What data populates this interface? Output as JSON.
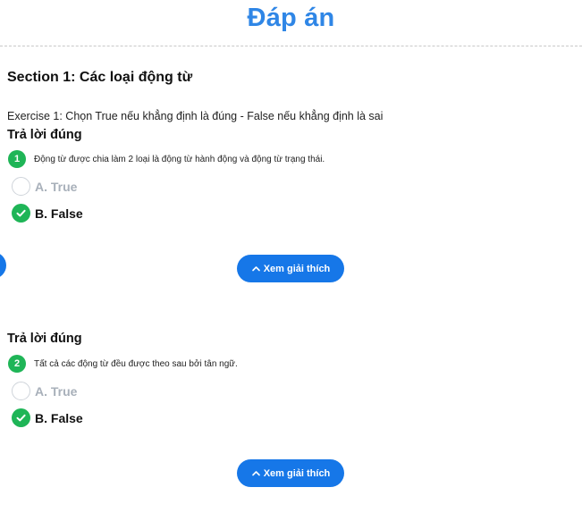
{
  "page": {
    "title": "Đáp án"
  },
  "section": {
    "title": "Section 1: Các loại động từ"
  },
  "exercise": {
    "instruction": "Exercise 1: Chọn True nếu khẳng định là đúng - False nếu khẳng định là sai"
  },
  "questions": [
    {
      "status": "Trả lời đúng",
      "number": "1",
      "text": "Động từ được chia làm 2 loại là động từ hành động và động từ trạng thái.",
      "options": [
        {
          "label": "A. True",
          "selected": false
        },
        {
          "label": "B. False",
          "selected": true
        }
      ],
      "explain_button": "Xem giải thích"
    },
    {
      "status": "Trả lời đúng",
      "number": "2",
      "text": "Tất cả các động từ đều được theo sau bởi tân ngữ.",
      "options": [
        {
          "label": "A. True",
          "selected": false
        },
        {
          "label": "B. False",
          "selected": true
        }
      ],
      "explain_button": "Xem giải thích"
    }
  ],
  "colors": {
    "title": "#2f86e6",
    "correct": "#1fb557",
    "button": "#1677e8",
    "muted": "#a8b0ba"
  },
  "icons": {
    "correct": "check-circle-icon",
    "unselected": "radio-empty-icon",
    "explain": "chevron-up-icon"
  }
}
